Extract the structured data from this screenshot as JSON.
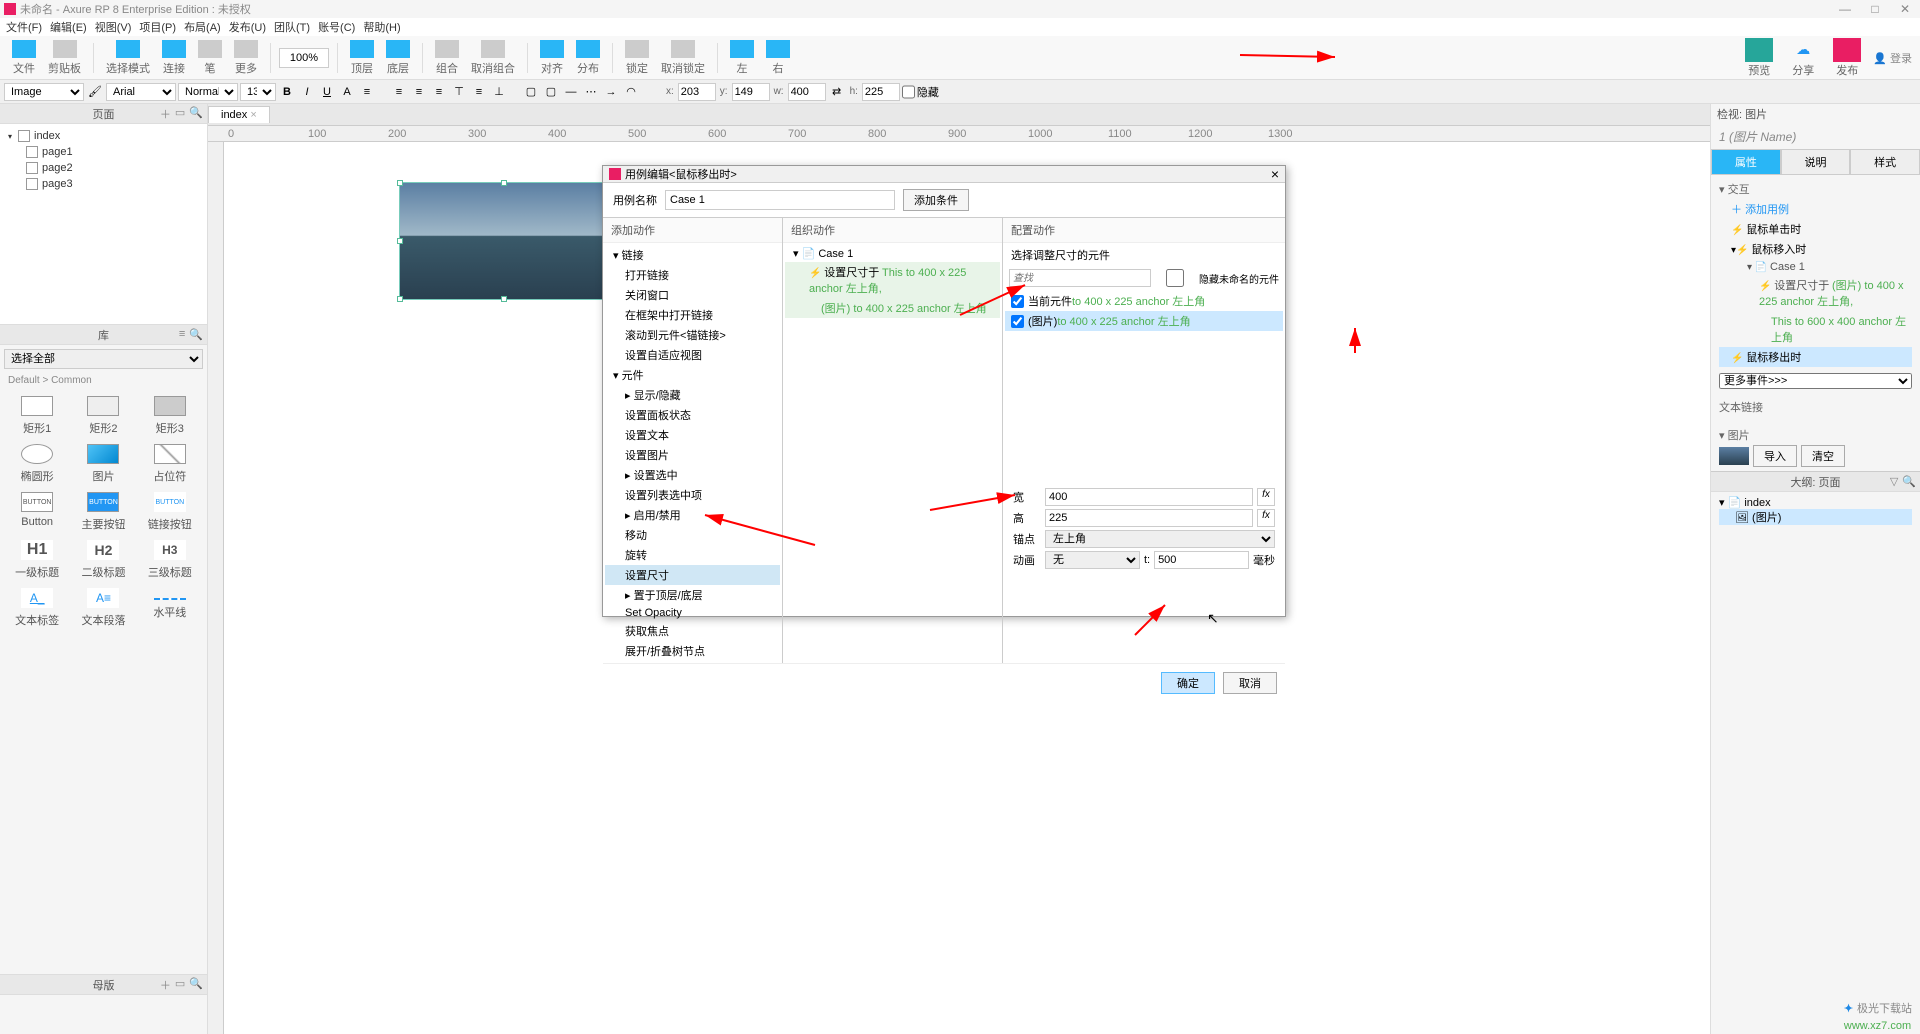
{
  "app": {
    "title": "未命名 - Axure RP 8 Enterprise Edition : 未授权",
    "login": "登录"
  },
  "menu": [
    "文件(F)",
    "编辑(E)",
    "视图(V)",
    "项目(P)",
    "布局(A)",
    "发布(U)",
    "团队(T)",
    "账号(C)",
    "帮助(H)"
  ],
  "toolbar": {
    "file": "文件",
    "clipboard": "剪贴板",
    "select_mode": "选择模式",
    "connect": "连接",
    "pen": "笔",
    "more": "更多",
    "zoom": "100%",
    "top": "顶层",
    "bottom": "底层",
    "group": "组合",
    "ungroup": "取消组合",
    "align": "对齐",
    "distribute": "分布",
    "lock": "锁定",
    "unlock": "取消锁定",
    "left": "左",
    "right": "右",
    "preview": "预览",
    "share": "分享",
    "publish": "发布"
  },
  "format": {
    "widget_type": "Image",
    "font": "Arial",
    "weight": "Normal",
    "size": "13",
    "x_label": "x:",
    "x": "203",
    "y_label": "y:",
    "y": "149",
    "w_label": "w:",
    "w": "400",
    "h_label": "h:",
    "h": "225",
    "hide": "隐藏"
  },
  "pages": {
    "header": "页面",
    "items": [
      {
        "name": "index",
        "children": [
          "page1",
          "page2",
          "page3"
        ]
      }
    ]
  },
  "library": {
    "header": "库",
    "select": "选择全部",
    "category": "Default > Common",
    "items": [
      "矩形1",
      "矩形2",
      "矩形3",
      "椭圆形",
      "图片",
      "占位符",
      "Button",
      "主要按钮",
      "链接按钮",
      "一级标题",
      "二级标题",
      "三级标题",
      "文本标签",
      "文本段落",
      "水平线"
    ]
  },
  "master": {
    "header": "母版"
  },
  "canvas": {
    "tab": "index",
    "ruler": [
      100,
      200,
      300,
      400,
      500,
      600,
      700,
      800,
      900,
      1000,
      1100,
      1200,
      1300
    ]
  },
  "dialog": {
    "title": "用例编辑<鼠标移出时>",
    "case_name_label": "用例名称",
    "case_name": "Case 1",
    "add_condition": "添加条件",
    "col1": "添加动作",
    "col2": "组织动作",
    "col3": "配置动作",
    "actions": {
      "link": {
        "label": "链接",
        "items": [
          "打开链接",
          "关闭窗口",
          "在框架中打开链接",
          "滚动到元件<锚链接>",
          "设置自适应视图"
        ]
      },
      "widget": {
        "label": "元件",
        "items": [
          "显示/隐藏",
          "设置面板状态",
          "设置文本",
          "设置图片",
          "设置选中",
          "设置列表选中项",
          "启用/禁用",
          "移动",
          "旋转",
          "设置尺寸",
          "置于顶层/底层",
          "Set Opacity",
          "获取焦点",
          "展开/折叠树节点"
        ]
      }
    },
    "selected_action_index": 9,
    "organize": {
      "case": "Case 1",
      "action_pre": "设置尺寸于",
      "action_desc": "This to 400 x 225 anchor 左上角,",
      "action_desc2": "(图片) to 400 x 225 anchor 左上角"
    },
    "config": {
      "header": "选择调整尺寸的元件",
      "search_placeholder": "查找",
      "hide_unnamed": "隐藏未命名的元件",
      "items": [
        {
          "label": "当前元件",
          "desc": "to 400 x 225 anchor 左上角",
          "checked": true
        },
        {
          "label": "(图片)",
          "desc": "to 400 x 225 anchor 左上角",
          "checked": true
        }
      ],
      "w_label": "宽",
      "w": "400",
      "h_label": "高",
      "h": "225",
      "anchor_label": "锚点",
      "anchor": "左上角",
      "anim_label": "动画",
      "anim": "无",
      "t_label": "t:",
      "t": "500",
      "ms": "毫秒"
    },
    "ok": "确定",
    "cancel": "取消"
  },
  "inspector": {
    "header": "检视: 图片",
    "name": "1  (图片 Name)",
    "tabs": [
      "属性",
      "说明",
      "样式"
    ],
    "interaction": "交互",
    "add_case": "添加用例",
    "events": [
      {
        "name": "鼠标单击时"
      },
      {
        "name": "鼠标移入时",
        "case": "Case 1",
        "action_pre": "设置尺寸于",
        "action_g": "(图片) to 400 x 225 anchor 左上角,",
        "action2": "This to 600 x 400 anchor 左上角"
      },
      {
        "name": "鼠标移出时",
        "selected": true
      }
    ],
    "more_events": "更多事件>>>",
    "text_link": "文本链接",
    "image_section": "图片",
    "import": "导入",
    "clear": "清空",
    "outline_header": "大纲: 页面",
    "outline": [
      {
        "name": "index",
        "children": [
          "(图片)"
        ]
      }
    ]
  },
  "watermark": {
    "brand": "极光下载站",
    "url": "www.xz7.com"
  }
}
